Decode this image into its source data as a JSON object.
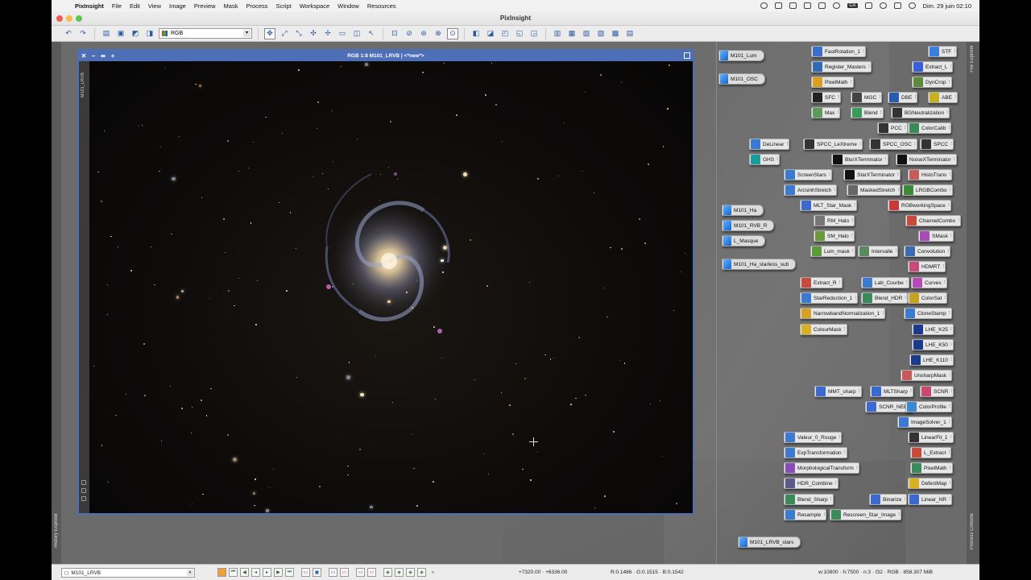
{
  "menubar": {
    "app": "PixInsight",
    "items": [
      "File",
      "Edit",
      "View",
      "Image",
      "Preview",
      "Mask",
      "Process",
      "Script",
      "Workspace",
      "Window",
      "Resources"
    ],
    "clock": "Dim. 29 juin 02:10",
    "ca_label": "CA"
  },
  "window": {
    "title": "PixInsight"
  },
  "toolbar": {
    "colorspace_select": "RGB"
  },
  "image_window": {
    "title": "RGB 1:8 M101_LRVB | <*new*>",
    "side_label": "M101_LRVB"
  },
  "image_icons": [
    {
      "label": "M101_Lum"
    },
    {
      "label": "M101_OSC"
    },
    {
      "label": "M101_Ha"
    },
    {
      "label": "M101_RVB_R"
    },
    {
      "label": "L_Masque"
    },
    {
      "label": "M101_Ha_starless_sub"
    },
    {
      "label": "M101_LRVB_stars"
    }
  ],
  "process_icons": [
    {
      "label": "FastRotation_1",
      "color": "#3a6fd0"
    },
    {
      "label": "STF",
      "color": "#3a7fe0"
    },
    {
      "label": "Register_Masters",
      "color": "#2f6ab8"
    },
    {
      "label": "Extract_L",
      "color": "#3a5fd8"
    },
    {
      "label": "PixelMath",
      "color": "#d8a020"
    },
    {
      "label": "DynCrop",
      "color": "#5a8a3a"
    },
    {
      "label": "SFC",
      "color": "#222222"
    },
    {
      "label": "MGC",
      "color": "#444444"
    },
    {
      "label": "DBE",
      "color": "#2a5ab0"
    },
    {
      "label": "ABE",
      "color": "#c8b020"
    },
    {
      "label": "Max",
      "color": "#5a9a5a"
    },
    {
      "label": "Blend",
      "color": "#3a9a5a"
    },
    {
      "label": "BGNeutralization",
      "color": "#333333"
    },
    {
      "label": "PCC",
      "color": "#333333"
    },
    {
      "label": "ColorCalib",
      "color": "#3a8a5a"
    },
    {
      "label": "DeLinear",
      "color": "#3a7ad0"
    },
    {
      "label": "SPCC_LeXtreme",
      "color": "#333333"
    },
    {
      "label": "SPCC_OSC",
      "color": "#333333"
    },
    {
      "label": "SPCC",
      "color": "#333333"
    },
    {
      "label": "GHS",
      "color": "#1a9a9a"
    },
    {
      "label": "BlurXTerminator",
      "color": "#111111"
    },
    {
      "label": "NoiseXTerminator",
      "color": "#111111"
    },
    {
      "label": "ScreenStars",
      "color": "#3a7ad0"
    },
    {
      "label": "StarXTerminator",
      "color": "#111111"
    },
    {
      "label": "HistoTrans",
      "color": "#c85a5a"
    },
    {
      "label": "ArcsinhStretch",
      "color": "#3a7ad0"
    },
    {
      "label": "MaskedStretch",
      "color": "#666666"
    },
    {
      "label": "LRGBCombo",
      "color": "#3a8a3a"
    },
    {
      "label": "MLT_Star_Mask",
      "color": "#3a6ad0"
    },
    {
      "label": "RGBworkingSpace",
      "color": "#c83a3a"
    },
    {
      "label": "RM_Halo",
      "color": "#777777"
    },
    {
      "label": "ChannelCombo",
      "color": "#c84a3a"
    },
    {
      "label": "SM_Halo",
      "color": "#6a9a3a"
    },
    {
      "label": "SMask",
      "color": "#a84ab8"
    },
    {
      "label": "Lum_mask",
      "color": "#5a9a3a"
    },
    {
      "label": "Intervalle",
      "color": "#5a8a5a"
    },
    {
      "label": "Convolution",
      "color": "#3a6ab0"
    },
    {
      "label": "HDMRT",
      "color": "#c84a7a"
    },
    {
      "label": "Extract_R",
      "color": "#c84a3a"
    },
    {
      "label": "Lab_Courbe",
      "color": "#3a7ad0"
    },
    {
      "label": "Curves",
      "color": "#b84ab8"
    },
    {
      "label": "StarReduction_1",
      "color": "#3a7ad0"
    },
    {
      "label": "Blend_HDR",
      "color": "#3a8a5a"
    },
    {
      "label": "ColorSat",
      "color": "#c8a020"
    },
    {
      "label": "NarrowbandNormalization_1",
      "color": "#d8a020"
    },
    {
      "label": "CloneStamp",
      "color": "#3a7ad0"
    },
    {
      "label": "ColourMask",
      "color": "#d8b020"
    },
    {
      "label": "LHE_K25",
      "color": "#1a3a8a"
    },
    {
      "label": "LHE_K50",
      "color": "#1a3a8a"
    },
    {
      "label": "LHE_K110",
      "color": "#1a3a8a"
    },
    {
      "label": "UnsharpMask",
      "color": "#c85a5a"
    },
    {
      "label": "MMT_sharp",
      "color": "#3a6ad0"
    },
    {
      "label": "MLTSharp",
      "color": "#3a6ad0"
    },
    {
      "label": "SCNR",
      "color": "#c84a6a"
    },
    {
      "label": "SCNR_NEB",
      "color": "#3a6ad0"
    },
    {
      "label": "ColorProfile",
      "color": "#3a8ad0"
    },
    {
      "label": "ImageSolver_1",
      "color": "#3a7ad0"
    },
    {
      "label": "Valeur_0_Rouge",
      "color": "#3a7ad0"
    },
    {
      "label": "LinearFit_1",
      "color": "#333333"
    },
    {
      "label": "ExpTransformation",
      "color": "#3a7ad0"
    },
    {
      "label": "L_Extract",
      "color": "#c84a3a"
    },
    {
      "label": "MorphologicalTransform",
      "color": "#8a4ab8"
    },
    {
      "label": "PixelMath",
      "color": "#3a8a5a"
    },
    {
      "label": "HDR_Combine",
      "color": "#5a5a8a"
    },
    {
      "label": "DefectMap",
      "color": "#d8b020"
    },
    {
      "label": "Blend_Sharp",
      "color": "#3a8a5a"
    },
    {
      "label": "Binarize",
      "color": "#3a6ad0"
    },
    {
      "label": "Linear_NR",
      "color": "#3a6ad0"
    },
    {
      "label": "Resample",
      "color": "#3a7ad0"
    },
    {
      "label": "Rescreen_Star_Image",
      "color": "#3a8a5a"
    }
  ],
  "side_tabs": {
    "left": "History Explorer",
    "right_top": "File Explorer",
    "right_bottom": "Process Console"
  },
  "statusbar": {
    "view_select": "M101_LRVB",
    "coords": "+7320.00 · +6336.00",
    "rgb": "R:0.1486 · G:0.1515 · B:0.1542",
    "info": "w:10800 · h:7500 · n:3 · f32 · RGB · 858.307 MiB"
  }
}
